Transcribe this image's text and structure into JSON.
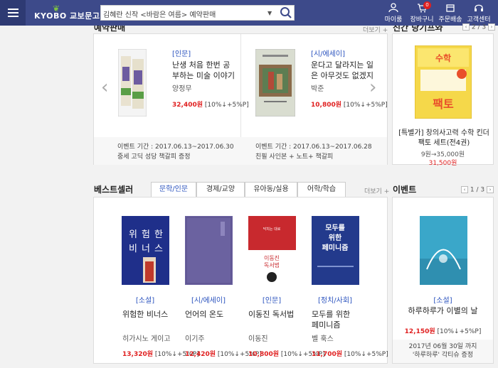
{
  "header": {
    "logo_text": "KYOBO 교보문고",
    "search_value": "김혜란 신작 <바람은 여름> 예약판매",
    "icons": [
      {
        "name": "mypage-icon",
        "label": "마이룸"
      },
      {
        "name": "cart-icon",
        "label": "장바구니",
        "badge": "0"
      },
      {
        "name": "delivery-icon",
        "label": "주문배송"
      },
      {
        "name": "headset-icon",
        "label": "고객센터"
      }
    ]
  },
  "preorder": {
    "title": "예약판매",
    "more": "더보기 +",
    "items": [
      {
        "category": "[인문]",
        "title": "난생 처음 한번 공부하는 미술 이야기 3.",
        "author": "양정무",
        "price": "32,400원",
        "discount": "[10%↓+5%P]",
        "event_period": "이벤트 기간 : 2017.06.13~2017.06.30",
        "event_gift": "중세 고딕 성당 책갈피 증정"
      },
      {
        "category": "[시/에세이]",
        "title": "운다고 달라지는 일은 아무것도 없겠지",
        "author": "박준",
        "price": "10,800원",
        "discount": "[10%↓+5%P]",
        "event_period": "이벤트 기간 : 2017.06.13~2017.06.28",
        "event_gift": "친필 사인본 + 노트+ 책갈피"
      }
    ]
  },
  "new_book": {
    "title": "신간 당기프와",
    "pager": "2 / 3",
    "cover_text": "창의사고력 수학 팩토",
    "name": "[특별가] 창의사고력 수학 킨더팩토 세트(전4권)",
    "orig_price": "9원→35,000원",
    "price": "31,500원"
  },
  "bestseller": {
    "title": "베스트셀러",
    "more": "더보기 +",
    "tabs": [
      "문학/인문",
      "경제/교양",
      "유아동/실용",
      "어학/학습"
    ],
    "items": [
      {
        "category": "[소설]",
        "title": "위험한 비너스",
        "author": "히가시노 게이고",
        "price": "13,320원",
        "discount": "[10%↓+5%P]"
      },
      {
        "category": "[시/에세이]",
        "title": "언어의 온도",
        "author": "이기주",
        "price": "12,420원",
        "discount": "[10%↓+5%P]"
      },
      {
        "category": "[인문]",
        "title": "이동진 독서법",
        "author": "이동진",
        "price": "10,800원",
        "discount": "[10%↓+5%P]"
      },
      {
        "category": "[정치/사회]",
        "title": "모두를 위한 페미니즘",
        "author": "벨 훅스",
        "price": "11,700원",
        "discount": "[10%↓+5%P]"
      }
    ]
  },
  "event": {
    "title": "이벤트",
    "pager": "1 / 3",
    "category": "[소설]",
    "book_title": "하루하루가 이별의 날",
    "price": "12,150원",
    "discount": "[10%↓+5%P]",
    "period": "2017년 06월 30일 까지",
    "gift": "'하루하루' 각티슈 증정"
  },
  "colors": {
    "header": "#3d4a8a",
    "accent": "#2a52be",
    "price": "#e02020"
  }
}
